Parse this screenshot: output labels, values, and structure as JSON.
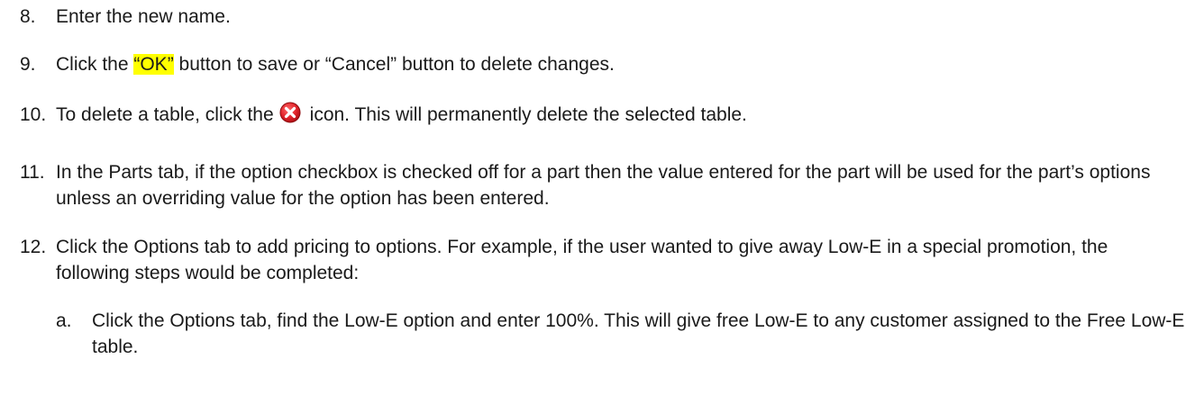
{
  "steps": [
    {
      "number": "8.",
      "text": "Enter the new name."
    },
    {
      "number": "9.",
      "before": "Click the ",
      "highlight": "“OK”",
      "after": " button to save or “Cancel” button to delete changes."
    },
    {
      "number": "10.",
      "before": "To delete a table, click the",
      "icon": "delete-icon",
      "after": "icon. This will permanently delete the selected table."
    },
    {
      "number": "11.",
      "text": "In the Parts tab, if the option checkbox is checked off for a part then the value entered for the part will be used for the part’s options unless an overriding value for the option has been entered."
    },
    {
      "number": "12.",
      "text": "Click the Options tab to add pricing to options.  For example, if the user wanted to give away Low-E in a special promotion, the following steps would be completed:"
    }
  ],
  "substeps": [
    {
      "letter": "a.",
      "text": "Click the Options tab, find the Low-E option and enter 100%.  This will give free Low-E to any customer assigned to the Free Low-E table."
    }
  ],
  "colors": {
    "highlight": "#ffff00",
    "delete_icon": "#d9141b",
    "text": "#1a1a1a"
  }
}
